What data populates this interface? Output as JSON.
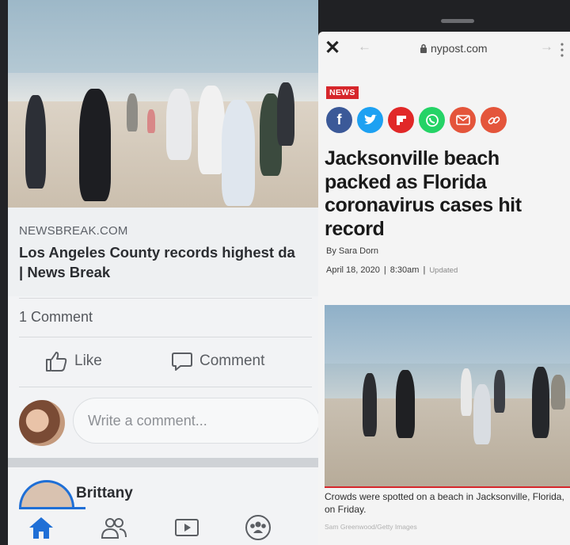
{
  "facebook": {
    "source": "NEWSBREAK.COM",
    "headline_line1": "Los Angeles County records highest da",
    "headline_line2": "| News Break",
    "comment_count": "1 Comment",
    "like_label": "Like",
    "comment_label": "Comment",
    "composer_placeholder": "Write a comment...",
    "commenter_name": "Brittany"
  },
  "nypost": {
    "domain": "nypost.com",
    "section_tag": "NEWS",
    "title": "Jacksonville beach packed as Florida coronavirus cases hit record",
    "byline": "By Sara Dorn",
    "date": "April 18, 2020",
    "time": "8:30am",
    "updated_label": "Updated",
    "caption": "Crowds were spotted on a beach in Jacksonville, Florida, on Friday.",
    "credit": "Sam Greenwood/Getty Images",
    "share_icons": [
      {
        "name": "facebook-icon",
        "glyph": "f",
        "color": "#3b5998"
      },
      {
        "name": "twitter-icon",
        "glyph": "t",
        "color": "#1da1f2"
      },
      {
        "name": "flipboard-icon",
        "glyph": "▮",
        "color": "#e12828"
      },
      {
        "name": "whatsapp-icon",
        "glyph": "✆",
        "color": "#25d366"
      },
      {
        "name": "email-icon",
        "glyph": "✉",
        "color": "#e4553b"
      },
      {
        "name": "link-icon",
        "glyph": "∞",
        "color": "#e4553b"
      }
    ]
  },
  "colors": {
    "facebook_blue": "#1f6fd6",
    "nypost_red": "#d6262b"
  }
}
